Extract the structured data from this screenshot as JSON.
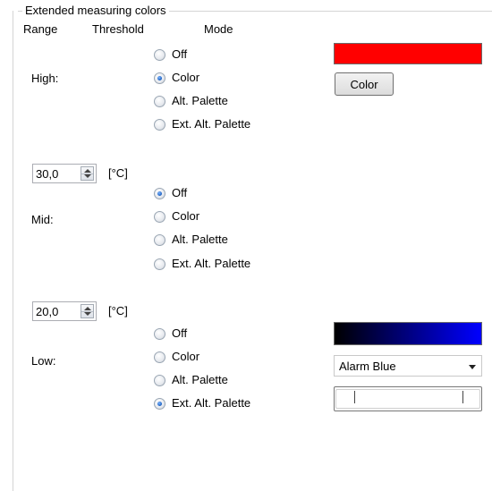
{
  "group": {
    "title": "Extended measuring colors"
  },
  "headers": {
    "range": "Range",
    "threshold": "Threshold",
    "mode": "Mode"
  },
  "high": {
    "label": "High:",
    "modes": [
      "Off",
      "Color",
      "Alt. Palette",
      "Ext. Alt. Palette"
    ],
    "selected_mode": "Color",
    "swatch_color": "#ff0000",
    "color_button": "Color"
  },
  "threshold_high": {
    "value": "30,0",
    "unit": "[°C]"
  },
  "mid": {
    "label": "Mid:",
    "modes": [
      "Off",
      "Color",
      "Alt. Palette",
      "Ext. Alt. Palette"
    ],
    "selected_mode": "Off"
  },
  "threshold_low": {
    "value": "20,0",
    "unit": "[°C]"
  },
  "low": {
    "label": "Low:",
    "modes": [
      "Off",
      "Color",
      "Alt. Palette",
      "Ext. Alt. Palette"
    ],
    "selected_mode": "Ext. Alt. Palette",
    "palette_gradient": [
      "#000000",
      "#0000ff"
    ],
    "palette_select": "Alarm Blue"
  }
}
